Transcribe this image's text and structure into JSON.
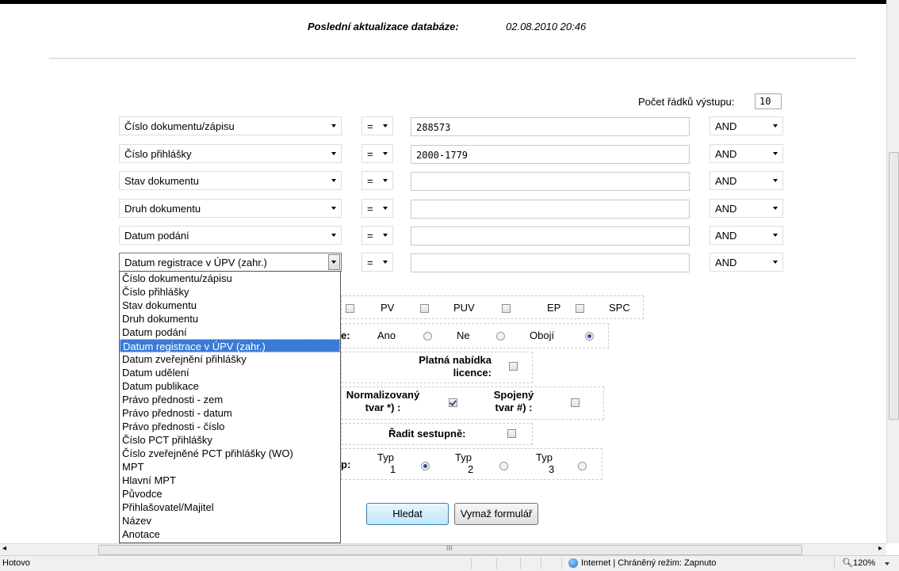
{
  "header": {
    "label": "Poslední aktualizace databáze:",
    "value": "02.08.2010 20:46"
  },
  "output_rows": {
    "label": "Počet řádků výstupu:",
    "value": "10"
  },
  "rows": [
    {
      "field": "Číslo dokumentu/zápisu",
      "op": "=",
      "value": "288573",
      "logic": "AND"
    },
    {
      "field": "Číslo přihlášky",
      "op": "=",
      "value": "2000-1779",
      "logic": "AND"
    },
    {
      "field": "Stav dokumentu",
      "op": "=",
      "value": "",
      "logic": "AND"
    },
    {
      "field": "Druh dokumentu",
      "op": "=",
      "value": "",
      "logic": "AND"
    },
    {
      "field": "Datum podání",
      "op": "=",
      "value": "",
      "logic": "AND"
    },
    {
      "field": "Datum registrace v ÚPV (zahr.)",
      "op": "=",
      "value": "",
      "logic": "AND"
    }
  ],
  "dropdown": {
    "selected_index": 5,
    "options": [
      "Číslo dokumentu/zápisu",
      "Číslo přihlášky",
      "Stav dokumentu",
      "Druh dokumentu",
      "Datum podání",
      "Datum registrace v ÚPV (zahr.)",
      "Datum zveřejnění přihlášky",
      "Datum udělení",
      "Datum publikace",
      "Právo přednosti - zem",
      "Právo přednosti - datum",
      "Právo přednosti - číslo",
      "Číslo PCT přihlášky",
      "Číslo zveřejněné PCT přihlášky (WO)",
      "MPT",
      "Hlavní MPT",
      "Původce",
      "Přihlašovatel/Majitel",
      "Název",
      "Anotace"
    ]
  },
  "doc_types": [
    {
      "label": "PV",
      "checked": false
    },
    {
      "label": "PUV",
      "checked": false
    },
    {
      "label": "EP",
      "checked": false
    },
    {
      "label": "SPC",
      "checked": false
    }
  ],
  "validity": {
    "label_fragment": "e:",
    "options": [
      {
        "label": "Ano",
        "selected": false
      },
      {
        "label": "Ne",
        "selected": false
      },
      {
        "label": "Obojí",
        "selected": true
      }
    ]
  },
  "license": {
    "label_line1": "Platná nabídka",
    "label_line2": "licence:",
    "checked": false
  },
  "normalized": {
    "label_line1": "Normalizovaný",
    "label_line2": "tvar *) :",
    "checked": true
  },
  "joined": {
    "label_line1": "Spojený",
    "label_line2": "tvar #) :",
    "checked": false
  },
  "sort_desc": {
    "label": "Řadit sestupně:",
    "checked": false
  },
  "output_type": {
    "label_fragment": "p:",
    "options": [
      {
        "line1": "Typ",
        "line2": "1",
        "selected": true
      },
      {
        "line1": "Typ",
        "line2": "2",
        "selected": false
      },
      {
        "line1": "Typ",
        "line2": "3",
        "selected": false
      }
    ]
  },
  "buttons": {
    "search": "Hledat",
    "clear": "Vymaž formulář"
  },
  "statusbar": {
    "left": "Hotovo",
    "zone": "Internet | Chráněný režim: Zapnuto",
    "zoom": "120%",
    "hscroll_grip": "III"
  }
}
